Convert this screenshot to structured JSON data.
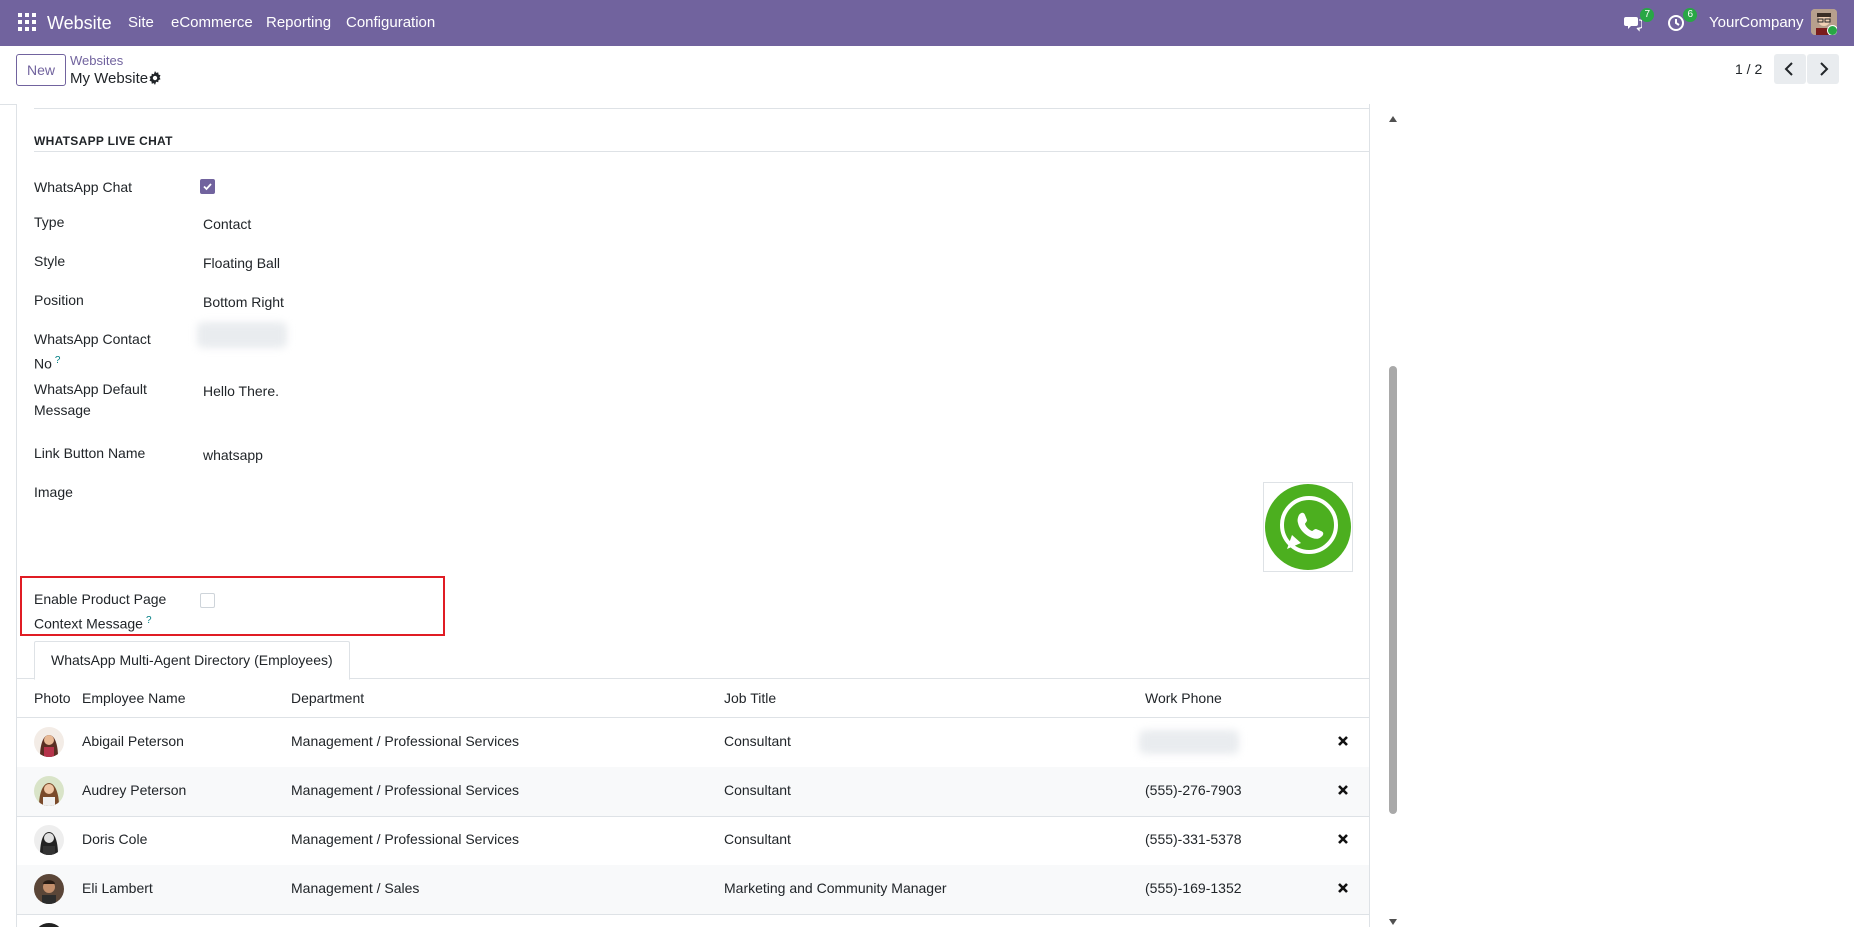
{
  "navbar": {
    "brand": "Website",
    "menu": [
      "Site",
      "eCommerce",
      "Reporting",
      "Configuration"
    ],
    "messages_count": "7",
    "activities_count": "6",
    "company": "YourCompany",
    "color": "#71639e"
  },
  "control": {
    "new_label": "New",
    "breadcrumb_parent": "Websites",
    "breadcrumb_current": "My Website",
    "pager": "1 / 2"
  },
  "section": {
    "title": "WHATSAPP LIVE CHAT"
  },
  "fields": {
    "whatsapp_chat": {
      "label": "WhatsApp Chat",
      "checked": true
    },
    "type": {
      "label": "Type",
      "value": "Contact"
    },
    "style": {
      "label": "Style",
      "value": "Floating Ball"
    },
    "position": {
      "label": "Position",
      "value": "Bottom Right"
    },
    "contact_no": {
      "label_line1": "WhatsApp Contact",
      "label_line2": "No",
      "help": "?"
    },
    "default_message": {
      "label_line1": "WhatsApp Default",
      "label_line2": "Message",
      "value": "Hello There."
    },
    "link_button_name": {
      "label": "Link Button Name",
      "value": "whatsapp"
    },
    "image": {
      "label": "Image",
      "icon": "whatsapp-logo-icon"
    },
    "product_context": {
      "label_line1": "Enable Product Page",
      "label_line2": "Context Message",
      "help": "?",
      "checked": false
    }
  },
  "tab": {
    "label": "WhatsApp Multi-Agent Directory (Employees)"
  },
  "table": {
    "headers": [
      "Photo",
      "Employee Name",
      "Department",
      "Job Title",
      "Work Phone"
    ],
    "rows": [
      {
        "name": "Abigail Peterson",
        "department": "Management / Professional Services",
        "job": "Consultant",
        "phone": ""
      },
      {
        "name": "Audrey Peterson",
        "department": "Management / Professional Services",
        "job": "Consultant",
        "phone": "(555)-276-7903"
      },
      {
        "name": "Doris Cole",
        "department": "Management / Professional Services",
        "job": "Consultant",
        "phone": "(555)-331-5378"
      },
      {
        "name": "Eli Lambert",
        "department": "Management / Sales",
        "job": "Marketing and Community Manager",
        "phone": "(555)-169-1352"
      }
    ]
  },
  "colors": {
    "primary": "#71639e",
    "highlight_border": "#e01c24",
    "whatsapp_green": "#4caf1f"
  }
}
